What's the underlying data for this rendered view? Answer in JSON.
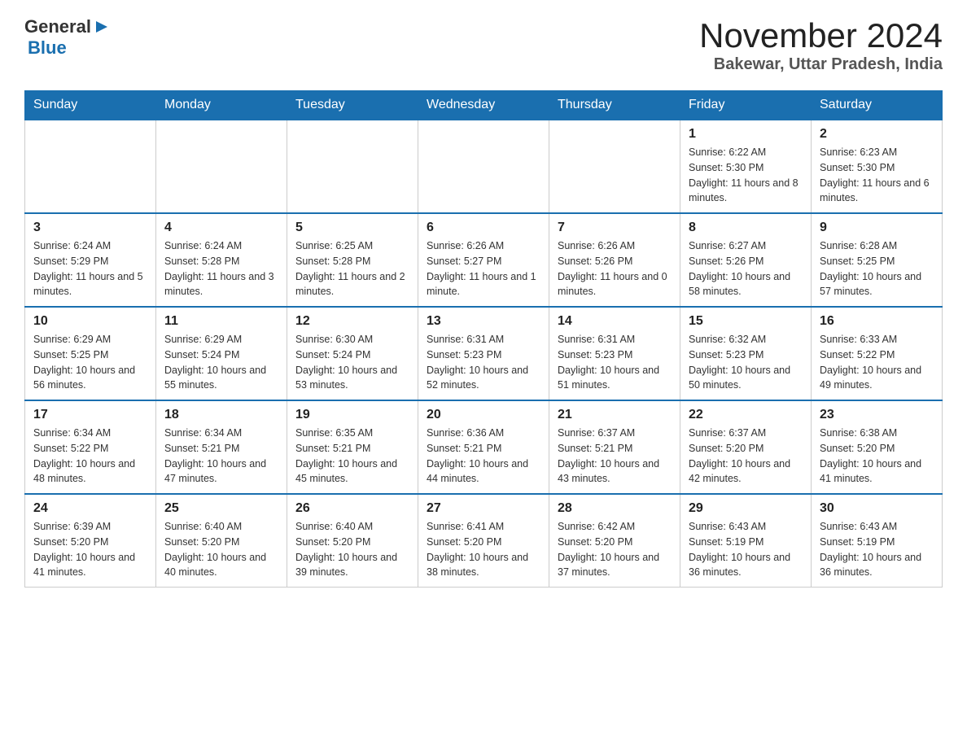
{
  "header": {
    "logo": {
      "general": "General",
      "blue": "Blue",
      "triangle": "▶"
    },
    "month": "November 2024",
    "location": "Bakewar, Uttar Pradesh, India"
  },
  "weekdays": [
    "Sunday",
    "Monday",
    "Tuesday",
    "Wednesday",
    "Thursday",
    "Friday",
    "Saturday"
  ],
  "weeks": [
    [
      {
        "day": "",
        "info": ""
      },
      {
        "day": "",
        "info": ""
      },
      {
        "day": "",
        "info": ""
      },
      {
        "day": "",
        "info": ""
      },
      {
        "day": "",
        "info": ""
      },
      {
        "day": "1",
        "info": "Sunrise: 6:22 AM\nSunset: 5:30 PM\nDaylight: 11 hours and 8 minutes."
      },
      {
        "day": "2",
        "info": "Sunrise: 6:23 AM\nSunset: 5:30 PM\nDaylight: 11 hours and 6 minutes."
      }
    ],
    [
      {
        "day": "3",
        "info": "Sunrise: 6:24 AM\nSunset: 5:29 PM\nDaylight: 11 hours and 5 minutes."
      },
      {
        "day": "4",
        "info": "Sunrise: 6:24 AM\nSunset: 5:28 PM\nDaylight: 11 hours and 3 minutes."
      },
      {
        "day": "5",
        "info": "Sunrise: 6:25 AM\nSunset: 5:28 PM\nDaylight: 11 hours and 2 minutes."
      },
      {
        "day": "6",
        "info": "Sunrise: 6:26 AM\nSunset: 5:27 PM\nDaylight: 11 hours and 1 minute."
      },
      {
        "day": "7",
        "info": "Sunrise: 6:26 AM\nSunset: 5:26 PM\nDaylight: 11 hours and 0 minutes."
      },
      {
        "day": "8",
        "info": "Sunrise: 6:27 AM\nSunset: 5:26 PM\nDaylight: 10 hours and 58 minutes."
      },
      {
        "day": "9",
        "info": "Sunrise: 6:28 AM\nSunset: 5:25 PM\nDaylight: 10 hours and 57 minutes."
      }
    ],
    [
      {
        "day": "10",
        "info": "Sunrise: 6:29 AM\nSunset: 5:25 PM\nDaylight: 10 hours and 56 minutes."
      },
      {
        "day": "11",
        "info": "Sunrise: 6:29 AM\nSunset: 5:24 PM\nDaylight: 10 hours and 55 minutes."
      },
      {
        "day": "12",
        "info": "Sunrise: 6:30 AM\nSunset: 5:24 PM\nDaylight: 10 hours and 53 minutes."
      },
      {
        "day": "13",
        "info": "Sunrise: 6:31 AM\nSunset: 5:23 PM\nDaylight: 10 hours and 52 minutes."
      },
      {
        "day": "14",
        "info": "Sunrise: 6:31 AM\nSunset: 5:23 PM\nDaylight: 10 hours and 51 minutes."
      },
      {
        "day": "15",
        "info": "Sunrise: 6:32 AM\nSunset: 5:23 PM\nDaylight: 10 hours and 50 minutes."
      },
      {
        "day": "16",
        "info": "Sunrise: 6:33 AM\nSunset: 5:22 PM\nDaylight: 10 hours and 49 minutes."
      }
    ],
    [
      {
        "day": "17",
        "info": "Sunrise: 6:34 AM\nSunset: 5:22 PM\nDaylight: 10 hours and 48 minutes."
      },
      {
        "day": "18",
        "info": "Sunrise: 6:34 AM\nSunset: 5:21 PM\nDaylight: 10 hours and 47 minutes."
      },
      {
        "day": "19",
        "info": "Sunrise: 6:35 AM\nSunset: 5:21 PM\nDaylight: 10 hours and 45 minutes."
      },
      {
        "day": "20",
        "info": "Sunrise: 6:36 AM\nSunset: 5:21 PM\nDaylight: 10 hours and 44 minutes."
      },
      {
        "day": "21",
        "info": "Sunrise: 6:37 AM\nSunset: 5:21 PM\nDaylight: 10 hours and 43 minutes."
      },
      {
        "day": "22",
        "info": "Sunrise: 6:37 AM\nSunset: 5:20 PM\nDaylight: 10 hours and 42 minutes."
      },
      {
        "day": "23",
        "info": "Sunrise: 6:38 AM\nSunset: 5:20 PM\nDaylight: 10 hours and 41 minutes."
      }
    ],
    [
      {
        "day": "24",
        "info": "Sunrise: 6:39 AM\nSunset: 5:20 PM\nDaylight: 10 hours and 41 minutes."
      },
      {
        "day": "25",
        "info": "Sunrise: 6:40 AM\nSunset: 5:20 PM\nDaylight: 10 hours and 40 minutes."
      },
      {
        "day": "26",
        "info": "Sunrise: 6:40 AM\nSunset: 5:20 PM\nDaylight: 10 hours and 39 minutes."
      },
      {
        "day": "27",
        "info": "Sunrise: 6:41 AM\nSunset: 5:20 PM\nDaylight: 10 hours and 38 minutes."
      },
      {
        "day": "28",
        "info": "Sunrise: 6:42 AM\nSunset: 5:20 PM\nDaylight: 10 hours and 37 minutes."
      },
      {
        "day": "29",
        "info": "Sunrise: 6:43 AM\nSunset: 5:19 PM\nDaylight: 10 hours and 36 minutes."
      },
      {
        "day": "30",
        "info": "Sunrise: 6:43 AM\nSunset: 5:19 PM\nDaylight: 10 hours and 36 minutes."
      }
    ]
  ]
}
